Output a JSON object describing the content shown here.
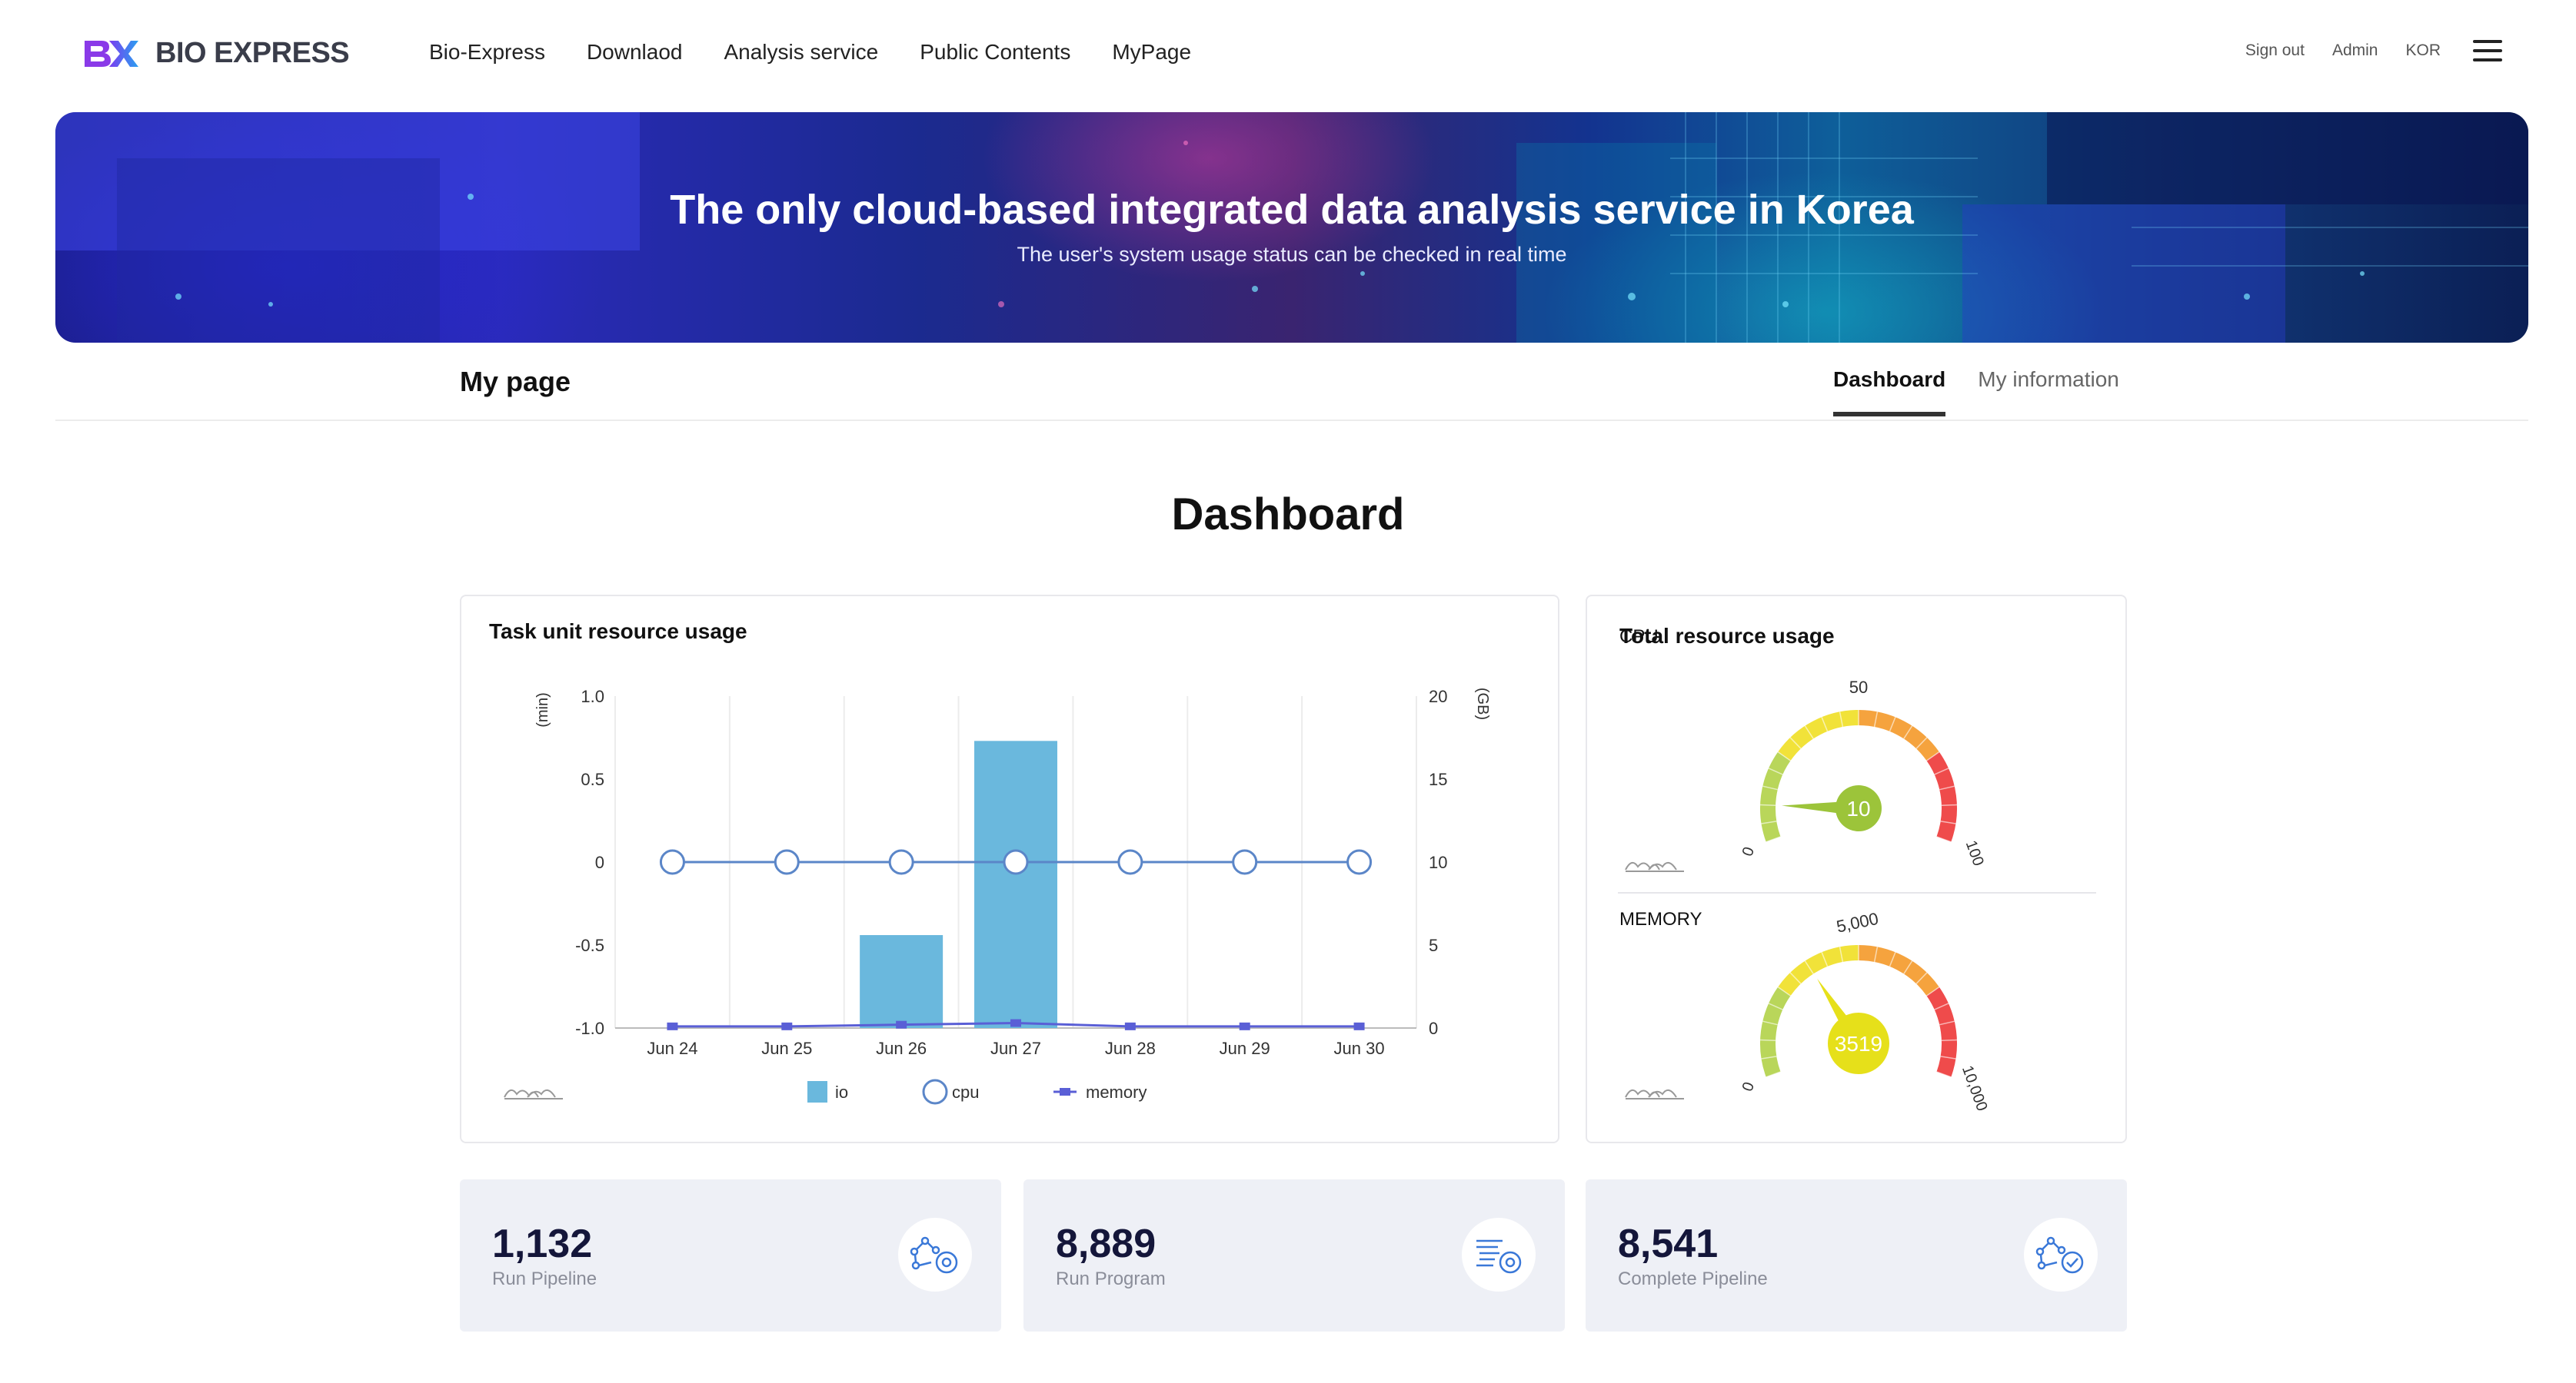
{
  "header": {
    "logo_mark": "BX",
    "logo_text": "BIO EXPRESS",
    "nav": [
      "Bio-Express",
      "Downlaod",
      "Analysis service",
      "Public Contents",
      "MyPage"
    ],
    "util": {
      "sign_out": "Sign out",
      "admin": "Admin",
      "lang": "KOR"
    },
    "menu_icon": "hamburger-icon"
  },
  "banner": {
    "title": "The only cloud-based integrated data analysis service in Korea",
    "subtitle": "The user's system usage status can be checked in real time"
  },
  "page": {
    "title": "My page",
    "tabs": [
      {
        "label": "Dashboard",
        "active": true
      },
      {
        "label": "My information",
        "active": false
      }
    ],
    "dashboard_title": "Dashboard"
  },
  "task_chart": {
    "title": "Task unit resource usage",
    "chart_data": {
      "type": "bar",
      "categories": [
        "Jun 24",
        "Jun 25",
        "Jun 26",
        "Jun 27",
        "Jun 28",
        "Jun 29",
        "Jun 30"
      ],
      "y_left": {
        "label": "(min)",
        "ticks": [
          "1.0",
          "0.5",
          "0",
          "-0.5",
          "-1.0"
        ],
        "range": [
          -1.0,
          1.0
        ]
      },
      "y_right": {
        "label": "(GB)",
        "ticks": [
          "20",
          "15",
          "10",
          "5",
          "0"
        ],
        "range": [
          0,
          20
        ]
      },
      "series": [
        {
          "name": "io",
          "type": "bar",
          "axis": "right",
          "color": "#6ab8dd",
          "values": [
            0,
            0,
            5.6,
            17.3,
            0,
            0,
            0
          ]
        },
        {
          "name": "cpu",
          "type": "line",
          "axis": "left",
          "color": "#5b86c8",
          "values": [
            0,
            0,
            0,
            0,
            0,
            0,
            0
          ]
        },
        {
          "name": "memory",
          "type": "line",
          "axis": "right",
          "color": "#5a5fd6",
          "values": [
            0.1,
            0.1,
            0.2,
            0.3,
            0.1,
            0.1,
            0.1
          ]
        }
      ],
      "legend": {
        "position": "bottom",
        "items": [
          "io",
          "cpu",
          "memory"
        ]
      }
    }
  },
  "total_usage": {
    "title": "Total resource usage",
    "gauges": [
      {
        "name": "CPU",
        "value": 10,
        "display": "10",
        "min_label": "0",
        "mid_label": "50",
        "max_label": "100",
        "min": 0,
        "max": 100,
        "bubble_color": "#9cc43a"
      },
      {
        "name": "MEMORY",
        "value": 3519,
        "display": "3519",
        "min_label": "0",
        "mid_label": "5,000",
        "max_label": "10,000",
        "min": 0,
        "max": 10000,
        "bubble_color": "#e6e01a"
      }
    ]
  },
  "stats": [
    {
      "value": "1,132",
      "label": "Run Pipeline",
      "icon": "pipeline-gear-icon"
    },
    {
      "value": "8,889",
      "label": "Run Program",
      "icon": "program-gear-icon"
    },
    {
      "value": "8,541",
      "label": "Complete Pipeline",
      "icon": "pipeline-check-icon"
    }
  ]
}
